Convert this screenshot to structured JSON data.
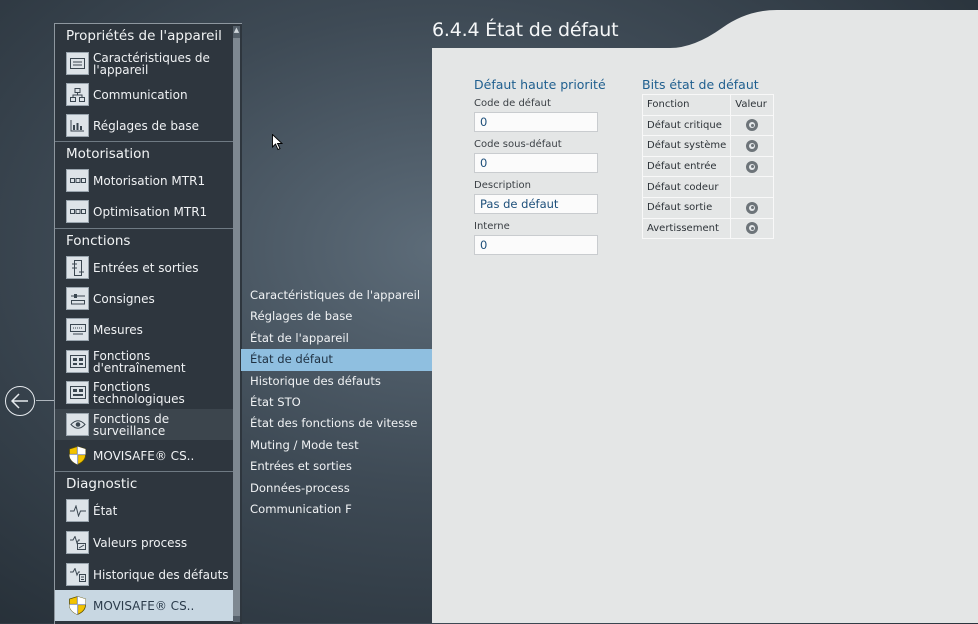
{
  "sidebar": {
    "groups": [
      {
        "title": "Propriétés de l'appareil",
        "items": [
          {
            "label": "Caractéristiques de l'appareil",
            "icon": "device-data-icon"
          },
          {
            "label": "Communication",
            "icon": "network-icon"
          },
          {
            "label": "Réglages de base",
            "icon": "basic-settings-icon"
          }
        ]
      },
      {
        "title": "Motorisation",
        "items": [
          {
            "label": "Motorisation MTR1",
            "icon": "drive-icon"
          },
          {
            "label": "Optimisation MTR1",
            "icon": "drive-icon"
          }
        ]
      },
      {
        "title": "Fonctions",
        "items": [
          {
            "label": "Entrées et sorties",
            "icon": "io-icon"
          },
          {
            "label": "Consignes",
            "icon": "setpoint-icon"
          },
          {
            "label": "Mesures",
            "icon": "measure-icon"
          },
          {
            "label": "Fonctions d'entraînement",
            "icon": "drive-functions-icon"
          },
          {
            "label": "Fonctions technologiques",
            "icon": "technology-functions-icon"
          },
          {
            "label": "Fonctions de surveillance",
            "icon": "eye-icon"
          },
          {
            "label": "MOVISAFE® CS..",
            "icon": "shield-icon"
          }
        ]
      },
      {
        "title": "Diagnostic",
        "items": [
          {
            "label": "État",
            "icon": "pulse-icon"
          },
          {
            "label": "Valeurs process",
            "icon": "process-values-icon"
          },
          {
            "label": "Historique des défauts",
            "icon": "fault-history-icon"
          },
          {
            "label": "MOVISAFE® CS..",
            "icon": "shield-icon"
          }
        ]
      }
    ]
  },
  "subnav": {
    "items": [
      "Caractéristiques de l'appareil",
      "Réglages de base",
      "État de l'appareil",
      "État de défaut",
      "Historique des défauts",
      "État STO",
      "État des fonctions de vitesse",
      "Muting / Mode test",
      "Entrées et sorties",
      "Données-process",
      "Communication F"
    ],
    "active_index": 3
  },
  "page": {
    "title": "6.4.4 État de défaut"
  },
  "fault": {
    "section_title": "Défaut haute priorité",
    "fields": [
      {
        "label": "Code de défaut",
        "value": "0"
      },
      {
        "label": "Code sous-défaut",
        "value": "0"
      },
      {
        "label": "Description",
        "value": "Pas de défaut"
      },
      {
        "label": "Interne",
        "value": "0"
      }
    ]
  },
  "bits": {
    "section_title": "Bits état de défaut",
    "col_function": "Fonction",
    "col_value": "Valeur",
    "rows": [
      {
        "label": "Défaut critique",
        "led": true
      },
      {
        "label": "Défaut système",
        "led": true
      },
      {
        "label": "Défaut entrée",
        "led": true
      },
      {
        "label": "Défaut codeur",
        "led": false
      },
      {
        "label": "Défaut sortie",
        "led": true
      },
      {
        "label": "Avertissement",
        "led": true
      }
    ]
  },
  "colors": {
    "accent": "#1f5f8f",
    "subnav_active": "#8fbfe0",
    "sidebar_selected": "#c8d7e2"
  }
}
